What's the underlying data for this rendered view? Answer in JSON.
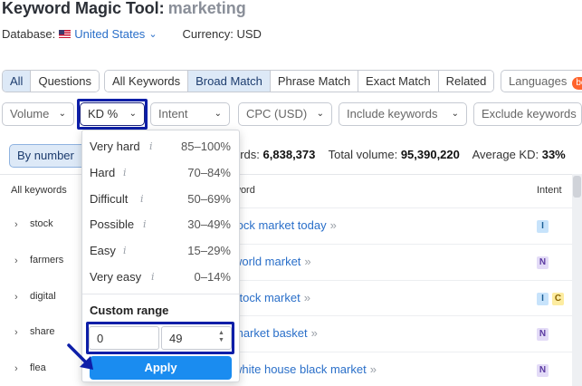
{
  "header": {
    "title": "Keyword Magic Tool:",
    "keyword": "marketing",
    "database_label": "Database:",
    "database_value": "United States",
    "currency": "Currency: USD"
  },
  "tabs_group1": [
    "All",
    "Questions"
  ],
  "tabs_group2": [
    "All Keywords",
    "Broad Match",
    "Phrase Match",
    "Exact Match",
    "Related"
  ],
  "languages_label": "Languages",
  "languages_badge": "beta",
  "filters": {
    "volume": "Volume",
    "kd": "KD %",
    "intent": "Intent",
    "cpc": "CPC (USD)",
    "include": "Include keywords",
    "exclude": "Exclude keywords"
  },
  "group_by": "By number",
  "summary": {
    "words_prefix": "ords:",
    "words_value": "6,838,373",
    "volume_prefix": "Total volume:",
    "volume_value": "95,390,220",
    "kd_prefix": "Average KD:",
    "kd_value": "33%"
  },
  "table_headers": {
    "all_keywords": "All keywords",
    "keyword": "word",
    "intent": "Intent"
  },
  "sidebar_groups": [
    "stock",
    "farmers",
    "digital",
    "share",
    "flea"
  ],
  "keywords": [
    {
      "text": "tock market today",
      "intents": [
        "I"
      ]
    },
    {
      "text": "world market",
      "intents": [
        "N"
      ]
    },
    {
      "text": "stock market",
      "intents": [
        "I",
        "C"
      ]
    },
    {
      "text": "market basket",
      "intents": [
        "N"
      ]
    },
    {
      "text": "white house black market",
      "intents": [
        "N"
      ]
    }
  ],
  "kd_dropdown": {
    "levels": [
      {
        "name": "Very hard",
        "range": "85–100%"
      },
      {
        "name": "Hard",
        "range": "70–84%"
      },
      {
        "name": "Difficult",
        "range": "50–69%"
      },
      {
        "name": "Possible",
        "range": "30–49%"
      },
      {
        "name": "Easy",
        "range": "15–29%"
      },
      {
        "name": "Very easy",
        "range": "0–14%"
      }
    ],
    "info_glyph": "i",
    "custom_range_label": "Custom range",
    "min_value": "0",
    "max_value": "49",
    "apply_label": "Apply"
  },
  "colors": {
    "accent": "#1a8cf0",
    "highlight_outline": "#0d1ea8",
    "link": "#2a6fc9",
    "tab_active_bg": "#dde9f7"
  },
  "icons": {
    "flag": "us-flag-icon",
    "pointer": "arrow-pointer-icon",
    "chevron": "chevron-down-icon"
  }
}
